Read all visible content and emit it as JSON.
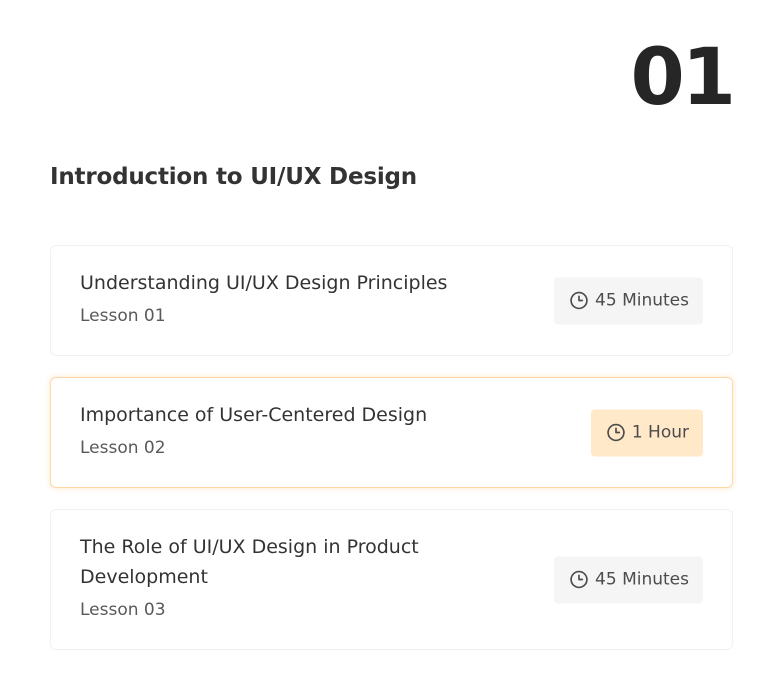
{
  "module": {
    "number": "01",
    "title": "Introduction to UI/UX Design"
  },
  "lessons": [
    {
      "title": "Understanding UI/UX Design Principles",
      "subtitle": "Lesson 01",
      "duration": "45 Minutes",
      "icon": "clock-icon",
      "active": false
    },
    {
      "title": "Importance of User-Centered Design",
      "subtitle": "Lesson 02",
      "duration": "1 Hour",
      "icon": "clock-icon",
      "active": true
    },
    {
      "title": "The Role of UI/UX Design in Product Development",
      "subtitle": "Lesson 03",
      "duration": "45 Minutes",
      "icon": "clock-icon",
      "active": false
    }
  ],
  "colors": {
    "text_primary": "#262626",
    "text_secondary": "#595959",
    "card_border": "#f1f1f3",
    "active_border": "#ffd8a6",
    "active_badge": "#ffe9c9",
    "badge_bg": "#f5f5f5"
  }
}
